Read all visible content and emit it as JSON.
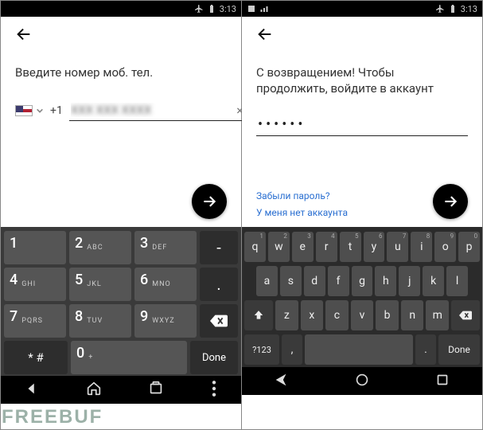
{
  "status": {
    "time": "3:13"
  },
  "left": {
    "prompt": "Введите номер моб. тел.",
    "country_code": "+1",
    "phone_value": "XXX XXX XXXX",
    "clear_glyph": "×"
  },
  "right": {
    "prompt": "С возвращением! Чтобы продолжить, войдите в аккаунт",
    "password_mask": "••••••",
    "forgot_label": "Забыли пароль?",
    "no_account_label": "У меня нет аккаунта"
  },
  "kb_num": {
    "rows": [
      [
        {
          "d": "1",
          "s": ""
        },
        {
          "d": "2",
          "s": "ABC"
        },
        {
          "d": "3",
          "s": "DEF"
        },
        {
          "d": "-",
          "narrow": true
        }
      ],
      [
        {
          "d": "4",
          "s": "GHI"
        },
        {
          "d": "5",
          "s": "JKL"
        },
        {
          "d": "6",
          "s": "MNO"
        },
        {
          "d": ".",
          "narrow": true
        }
      ],
      [
        {
          "d": "7",
          "s": "PQRS"
        },
        {
          "d": "8",
          "s": "TUV"
        },
        {
          "d": "9",
          "s": "WXYZ"
        },
        {
          "bksp": true
        }
      ]
    ],
    "bottom": {
      "sym": "* #",
      "zero": "0",
      "zero_sub": "+",
      "done": "Done"
    }
  },
  "kb_q": {
    "row1": [
      [
        "q",
        "1"
      ],
      [
        "w",
        "2"
      ],
      [
        "e",
        "3"
      ],
      [
        "r",
        "4"
      ],
      [
        "t",
        "5"
      ],
      [
        "y",
        "6"
      ],
      [
        "u",
        "7"
      ],
      [
        "i",
        "8"
      ],
      [
        "o",
        "9"
      ],
      [
        "p",
        "0"
      ]
    ],
    "row2": [
      "a",
      "s",
      "d",
      "f",
      "g",
      "h",
      "j",
      "k",
      "l"
    ],
    "row3": [
      "z",
      "x",
      "c",
      "v",
      "b",
      "n",
      "m"
    ],
    "bottom": {
      "sym": "?123",
      "comma": ",",
      "period": ".",
      "done": "Done"
    }
  },
  "watermark": "FREEBUF"
}
